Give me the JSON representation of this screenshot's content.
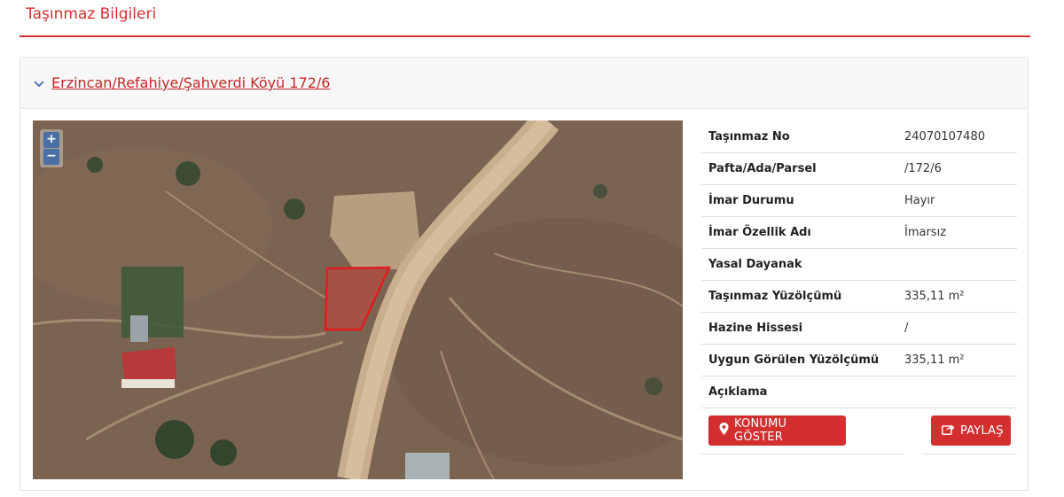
{
  "section": {
    "title": "Taşınmaz Bilgileri"
  },
  "panel": {
    "title": "Erzincan/Refahiye/Şahverdi Köyü 172/6"
  },
  "map": {
    "zoom_in": "+",
    "zoom_out": "−"
  },
  "info": {
    "rows": [
      {
        "label": "Taşınmaz No",
        "value": "24070107480"
      },
      {
        "label": "Pafta/Ada/Parsel",
        "value": "/172/6"
      },
      {
        "label": "İmar Durumu",
        "value": "Hayır"
      },
      {
        "label": "İmar Özellik Adı",
        "value": "İmarsız"
      },
      {
        "label": "Yasal Dayanak",
        "value": ""
      },
      {
        "label": "Taşınmaz Yüzölçümü",
        "value": "335,11 m²"
      },
      {
        "label": "Hazine Hissesi",
        "value": "/"
      },
      {
        "label": "Uygun Görülen Yüzölçümü",
        "value": "335,11 m²"
      },
      {
        "label": "Açıklama",
        "value": ""
      }
    ]
  },
  "buttons": {
    "show_location": "KONUMU GÖSTER",
    "share": "PAYLAŞ"
  },
  "colors": {
    "accent": "#d32f2f",
    "link": "#c62828",
    "zoom": "#4a6fa5"
  },
  "icons": {
    "panel_toggle": "chevron-down-icon",
    "locate": "map-marker-icon",
    "share": "share-icon"
  }
}
